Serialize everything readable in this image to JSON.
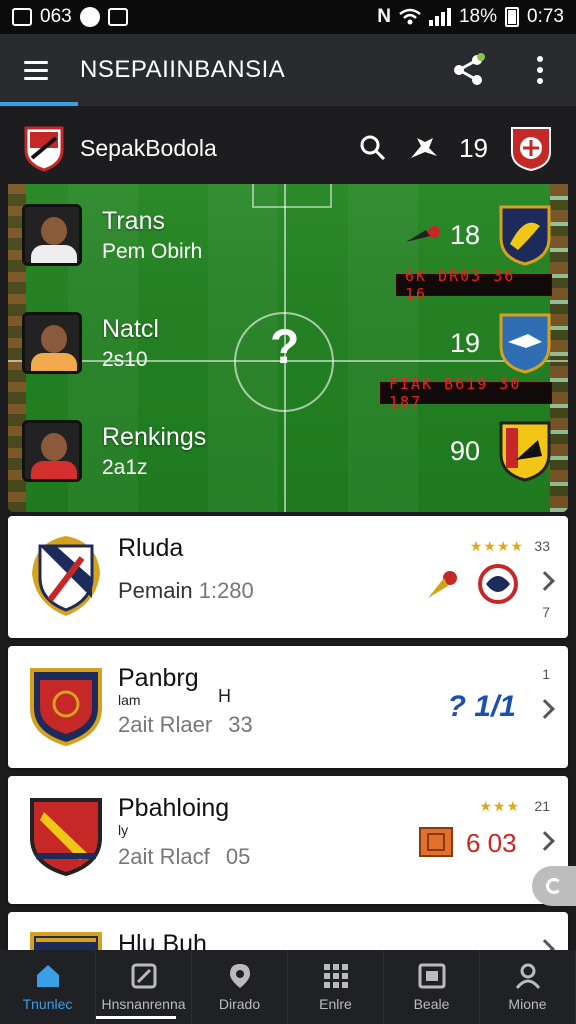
{
  "status_bar": {
    "left_text": "063",
    "battery": "18%",
    "time": "0:73"
  },
  "app_bar": {
    "title": "NSEPAIINBANSIA"
  },
  "match_card": {
    "header_title": "SepakBodola",
    "header_count": "19",
    "rows": [
      {
        "name": "Trans",
        "sub": "Pem Obirh",
        "score": "18",
        "ticker": "6K DR03 36 16"
      },
      {
        "name": "Natcl",
        "sub": "2s10",
        "score": "19",
        "ticker": "FIAK B619 30 187"
      },
      {
        "name": "Renkings",
        "sub": "2a1z",
        "score": "90"
      }
    ],
    "center_symbol": "?"
  },
  "list": [
    {
      "name": "Rluda",
      "sub": "Pemain",
      "sub_value": "1:280",
      "corner_top": "33",
      "corner_bottom": "7",
      "stars": "★★★★"
    },
    {
      "name": "Panbrg",
      "mini": "lam",
      "mini_mark": "H",
      "sub": "2ait Rlaer",
      "sub_value": "33",
      "corner_top": "1",
      "glyph": "? 1/1"
    },
    {
      "name": "Pbahloing",
      "mini": "ly",
      "sub": "2ait Rlacf",
      "sub_value": "05",
      "corner_top": "21",
      "stars": "★★★",
      "value": "6 03"
    },
    {
      "name": "Hlu Buh"
    }
  ],
  "bottom_nav": [
    {
      "label": "Tnunlec"
    },
    {
      "label": "Hnsnanrenna"
    },
    {
      "label": "Dirado"
    },
    {
      "label": "Enlre"
    },
    {
      "label": "Beale"
    },
    {
      "label": "Mione"
    }
  ],
  "colors": {
    "accent": "#3aa0e6",
    "pitch": "#248023",
    "ticker_red": "#e22222",
    "value_red": "#d2231e"
  }
}
